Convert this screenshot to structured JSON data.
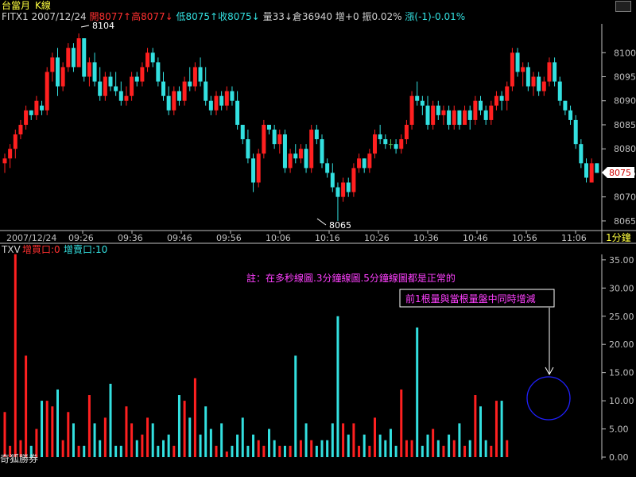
{
  "header": {
    "title": "台當月",
    "chart_kind": "K線"
  },
  "info_bar": {
    "symbol": "FITX1",
    "date": "2007/12/24",
    "open": "開8077↑",
    "high": "高8077↓",
    "low": "低8075↑",
    "close": "收8075↓",
    "volume": "量33↓",
    "open_interest": "倉36940",
    "oi_change": "增+0",
    "amplitude": "振0.02%",
    "change": "漲(-1)-0.01%"
  },
  "price_axis": {
    "ticks": [
      "8100",
      "8095",
      "8090",
      "8085",
      "8080",
      "8075",
      "8070",
      "8065"
    ],
    "current_price": "8075"
  },
  "time_axis": {
    "labels": [
      "2007/12/24",
      "09:26",
      "09:36",
      "09:46",
      "09:56",
      "10:06",
      "10:16",
      "10:26",
      "10:36",
      "10:46",
      "10:56",
      "11:06"
    ],
    "interval": "1分鐘"
  },
  "annotations": {
    "high_label": "8104",
    "low_label": "8065",
    "note": "註：在多秒線圖.3分鐘線圖.5分鐘線圖都是正常的",
    "callout": "前1根量與當根量盤中同時增減"
  },
  "volume_header": {
    "symbol": "TXV",
    "buy_label": "增買口:0",
    "sell_label": "增賣口:10"
  },
  "volume_axis": {
    "ticks": [
      "35.00",
      "30.00",
      "25.00",
      "20.00",
      "15.00",
      "10.00",
      "5.00",
      "0.00"
    ]
  },
  "watermark": "奇狐勝券",
  "colors": {
    "up": "#ff2020",
    "down": "#33e0e0",
    "flat": "#55c855",
    "axis": "#c0c0c0",
    "title": "#ffff40",
    "text_cyan": "#33e0e0",
    "note": "#ff40ff",
    "callout_circle": "#2020ff"
  },
  "chart_data": [
    {
      "type": "candlestick",
      "title": "",
      "ylim": [
        8063,
        8106
      ],
      "x_labels": [
        "09:26",
        "09:36",
        "09:46",
        "09:56",
        "10:06",
        "10:16",
        "10:26",
        "10:36",
        "10:46",
        "10:56",
        "11:06"
      ],
      "candles": [
        {
          "o": 8077,
          "h": 8079,
          "l": 8075,
          "c": 8078
        },
        {
          "o": 8078,
          "h": 8081,
          "l": 8076,
          "c": 8080
        },
        {
          "o": 8080,
          "h": 8084,
          "l": 8078,
          "c": 8083
        },
        {
          "o": 8083,
          "h": 8086,
          "l": 8082,
          "c": 8085
        },
        {
          "o": 8085,
          "h": 8089,
          "l": 8084,
          "c": 8088
        },
        {
          "o": 8088,
          "h": 8088,
          "l": 8086,
          "c": 8087
        },
        {
          "o": 8087,
          "h": 8091,
          "l": 8086,
          "c": 8090
        },
        {
          "o": 8089,
          "h": 8090,
          "l": 8087,
          "c": 8088
        },
        {
          "o": 8088,
          "h": 8097,
          "l": 8087,
          "c": 8096
        },
        {
          "o": 8096,
          "h": 8100,
          "l": 8094,
          "c": 8099
        },
        {
          "o": 8099,
          "h": 8101,
          "l": 8091,
          "c": 8093
        },
        {
          "o": 8093,
          "h": 8098,
          "l": 8092,
          "c": 8097
        },
        {
          "o": 8097,
          "h": 8102,
          "l": 8096,
          "c": 8101
        },
        {
          "o": 8101,
          "h": 8102,
          "l": 8096,
          "c": 8097
        },
        {
          "o": 8097,
          "h": 8104,
          "l": 8097,
          "c": 8103
        },
        {
          "o": 8103,
          "h": 8103,
          "l": 8094,
          "c": 8095
        },
        {
          "o": 8095,
          "h": 8099,
          "l": 8093,
          "c": 8098
        },
        {
          "o": 8098,
          "h": 8100,
          "l": 8093,
          "c": 8094
        },
        {
          "o": 8094,
          "h": 8097,
          "l": 8090,
          "c": 8091
        },
        {
          "o": 8091,
          "h": 8096,
          "l": 8090,
          "c": 8095
        },
        {
          "o": 8095,
          "h": 8096,
          "l": 8092,
          "c": 8093
        },
        {
          "o": 8093,
          "h": 8096,
          "l": 8091,
          "c": 8092
        },
        {
          "o": 8092,
          "h": 8094,
          "l": 8089,
          "c": 8090
        },
        {
          "o": 8090,
          "h": 8093,
          "l": 8089,
          "c": 8091
        },
        {
          "o": 8091,
          "h": 8096,
          "l": 8090,
          "c": 8095
        },
        {
          "o": 8095,
          "h": 8096,
          "l": 8093,
          "c": 8094
        },
        {
          "o": 8094,
          "h": 8098,
          "l": 8093,
          "c": 8097
        },
        {
          "o": 8097,
          "h": 8101,
          "l": 8096,
          "c": 8100
        },
        {
          "o": 8100,
          "h": 8101,
          "l": 8097,
          "c": 8098
        },
        {
          "o": 8098,
          "h": 8099,
          "l": 8093,
          "c": 8094
        },
        {
          "o": 8094,
          "h": 8096,
          "l": 8090,
          "c": 8091
        },
        {
          "o": 8091,
          "h": 8093,
          "l": 8087,
          "c": 8088
        },
        {
          "o": 8088,
          "h": 8093,
          "l": 8087,
          "c": 8092
        },
        {
          "o": 8092,
          "h": 8093,
          "l": 8089,
          "c": 8090
        },
        {
          "o": 8090,
          "h": 8095,
          "l": 8089,
          "c": 8094
        },
        {
          "o": 8094,
          "h": 8097,
          "l": 8092,
          "c": 8093
        },
        {
          "o": 8093,
          "h": 8098,
          "l": 8092,
          "c": 8097
        },
        {
          "o": 8097,
          "h": 8099,
          "l": 8093,
          "c": 8094
        },
        {
          "o": 8094,
          "h": 8097,
          "l": 8089,
          "c": 8090
        },
        {
          "o": 8090,
          "h": 8091,
          "l": 8087,
          "c": 8088
        },
        {
          "o": 8088,
          "h": 8092,
          "l": 8087,
          "c": 8091
        },
        {
          "o": 8091,
          "h": 8092,
          "l": 8088,
          "c": 8089
        },
        {
          "o": 8089,
          "h": 8093,
          "l": 8088,
          "c": 8092
        },
        {
          "o": 8092,
          "h": 8093,
          "l": 8089,
          "c": 8090
        },
        {
          "o": 8090,
          "h": 8092,
          "l": 8084,
          "c": 8085
        },
        {
          "o": 8085,
          "h": 8085,
          "l": 8081,
          "c": 8082
        },
        {
          "o": 8082,
          "h": 8084,
          "l": 8077,
          "c": 8078
        },
        {
          "o": 8078,
          "h": 8079,
          "l": 8071,
          "c": 8073
        },
        {
          "o": 8073,
          "h": 8080,
          "l": 8072,
          "c": 8079
        },
        {
          "o": 8079,
          "h": 8086,
          "l": 8078,
          "c": 8085
        },
        {
          "o": 8085,
          "h": 8085,
          "l": 8083,
          "c": 8084
        },
        {
          "o": 8084,
          "h": 8085,
          "l": 8080,
          "c": 8081
        },
        {
          "o": 8081,
          "h": 8084,
          "l": 8079,
          "c": 8083
        },
        {
          "o": 8083,
          "h": 8084,
          "l": 8075,
          "c": 8076
        },
        {
          "o": 8076,
          "h": 8080,
          "l": 8075,
          "c": 8079
        },
        {
          "o": 8079,
          "h": 8081,
          "l": 8077,
          "c": 8078
        },
        {
          "o": 8078,
          "h": 8081,
          "l": 8077,
          "c": 8080
        },
        {
          "o": 8080,
          "h": 8081,
          "l": 8075,
          "c": 8076
        },
        {
          "o": 8076,
          "h": 8085,
          "l": 8075,
          "c": 8084
        },
        {
          "o": 8084,
          "h": 8085,
          "l": 8081,
          "c": 8082
        },
        {
          "o": 8082,
          "h": 8083,
          "l": 8076,
          "c": 8077
        },
        {
          "o": 8077,
          "h": 8078,
          "l": 8074,
          "c": 8075
        },
        {
          "o": 8075,
          "h": 8077,
          "l": 8071,
          "c": 8072
        },
        {
          "o": 8072,
          "h": 8073,
          "l": 8065,
          "c": 8070
        },
        {
          "o": 8070,
          "h": 8074,
          "l": 8069,
          "c": 8073
        },
        {
          "o": 8073,
          "h": 8074,
          "l": 8070,
          "c": 8071
        },
        {
          "o": 8071,
          "h": 8077,
          "l": 8070,
          "c": 8076
        },
        {
          "o": 8076,
          "h": 8079,
          "l": 8075,
          "c": 8078
        },
        {
          "o": 8078,
          "h": 8078,
          "l": 8075,
          "c": 8076
        },
        {
          "o": 8076,
          "h": 8080,
          "l": 8075,
          "c": 8079
        },
        {
          "o": 8079,
          "h": 8084,
          "l": 8078,
          "c": 8083
        },
        {
          "o": 8083,
          "h": 8085,
          "l": 8081,
          "c": 8082
        },
        {
          "o": 8082,
          "h": 8083,
          "l": 8080,
          "c": 8081
        },
        {
          "o": 8081,
          "h": 8082,
          "l": 8080,
          "c": 8081
        },
        {
          "o": 8081,
          "h": 8082,
          "l": 8079,
          "c": 8080
        },
        {
          "o": 8080,
          "h": 8083,
          "l": 8079,
          "c": 8082
        },
        {
          "o": 8082,
          "h": 8086,
          "l": 8081,
          "c": 8085
        },
        {
          "o": 8085,
          "h": 8092,
          "l": 8084,
          "c": 8091
        },
        {
          "o": 8091,
          "h": 8094,
          "l": 8089,
          "c": 8090
        },
        {
          "o": 8090,
          "h": 8091,
          "l": 8087,
          "c": 8089
        },
        {
          "o": 8089,
          "h": 8091,
          "l": 8084,
          "c": 8085
        },
        {
          "o": 8085,
          "h": 8090,
          "l": 8084,
          "c": 8089
        },
        {
          "o": 8089,
          "h": 8090,
          "l": 8086,
          "c": 8087
        },
        {
          "o": 8087,
          "h": 8089,
          "l": 8085,
          "c": 8088
        },
        {
          "o": 8088,
          "h": 8089,
          "l": 8084,
          "c": 8085
        },
        {
          "o": 8085,
          "h": 8089,
          "l": 8084,
          "c": 8088
        },
        {
          "o": 8088,
          "h": 8088,
          "l": 8084,
          "c": 8085
        },
        {
          "o": 8085,
          "h": 8089,
          "l": 8085,
          "c": 8088
        },
        {
          "o": 8088,
          "h": 8089,
          "l": 8084,
          "c": 8086
        },
        {
          "o": 8086,
          "h": 8091,
          "l": 8085,
          "c": 8090
        },
        {
          "o": 8090,
          "h": 8091,
          "l": 8087,
          "c": 8088
        },
        {
          "o": 8088,
          "h": 8089,
          "l": 8085,
          "c": 8086
        },
        {
          "o": 8086,
          "h": 8090,
          "l": 8085,
          "c": 8089
        },
        {
          "o": 8089,
          "h": 8092,
          "l": 8088,
          "c": 8091
        },
        {
          "o": 8091,
          "h": 8092,
          "l": 8088,
          "c": 8090
        },
        {
          "o": 8090,
          "h": 8094,
          "l": 8088,
          "c": 8093
        },
        {
          "o": 8093,
          "h": 8101,
          "l": 8092,
          "c": 8100
        },
        {
          "o": 8100,
          "h": 8101,
          "l": 8095,
          "c": 8096
        },
        {
          "o": 8096,
          "h": 8098,
          "l": 8093,
          "c": 8097
        },
        {
          "o": 8097,
          "h": 8098,
          "l": 8092,
          "c": 8093
        },
        {
          "o": 8093,
          "h": 8096,
          "l": 8091,
          "c": 8095
        },
        {
          "o": 8095,
          "h": 8096,
          "l": 8091,
          "c": 8092
        },
        {
          "o": 8092,
          "h": 8095,
          "l": 8091,
          "c": 8094
        },
        {
          "o": 8094,
          "h": 8099,
          "l": 8093,
          "c": 8098
        },
        {
          "o": 8098,
          "h": 8099,
          "l": 8093,
          "c": 8094
        },
        {
          "o": 8094,
          "h": 8095,
          "l": 8089,
          "c": 8090
        },
        {
          "o": 8090,
          "h": 8090,
          "l": 8087,
          "c": 8088
        },
        {
          "o": 8088,
          "h": 8089,
          "l": 8085,
          "c": 8086
        },
        {
          "o": 8086,
          "h": 8087,
          "l": 8080,
          "c": 8081
        },
        {
          "o": 8081,
          "h": 8082,
          "l": 8076,
          "c": 8077
        },
        {
          "o": 8077,
          "h": 8078,
          "l": 8073,
          "c": 8074
        },
        {
          "o": 8073,
          "h": 8078,
          "l": 8073,
          "c": 8077
        },
        {
          "o": 8077,
          "h": 8077,
          "l": 8075,
          "c": 8075
        }
      ]
    },
    {
      "type": "bar",
      "title": "",
      "ylim": [
        0,
        37
      ],
      "colors_by": "candle direction (up = red, down = cyan)",
      "volumes": [
        8,
        2,
        36,
        3,
        18,
        2,
        5,
        10,
        10,
        9,
        12,
        3,
        8,
        6,
        2,
        2,
        11,
        6,
        3,
        7,
        13,
        2,
        2,
        9,
        6,
        3,
        4,
        7,
        6,
        2,
        3,
        4,
        2,
        11,
        10,
        7,
        14,
        4,
        9,
        5,
        2,
        6,
        1,
        2,
        4,
        7,
        2,
        4,
        3,
        2,
        5,
        3,
        2,
        2,
        2,
        18,
        3,
        6,
        3,
        2,
        3,
        3,
        6,
        25,
        6,
        4,
        6,
        2,
        4,
        2,
        7,
        4,
        3,
        5,
        2,
        12,
        3,
        3,
        23,
        2,
        4,
        5,
        3,
        2,
        4,
        3,
        6,
        2,
        3,
        11,
        9,
        3,
        2,
        10,
        10,
        3
      ]
    }
  ]
}
